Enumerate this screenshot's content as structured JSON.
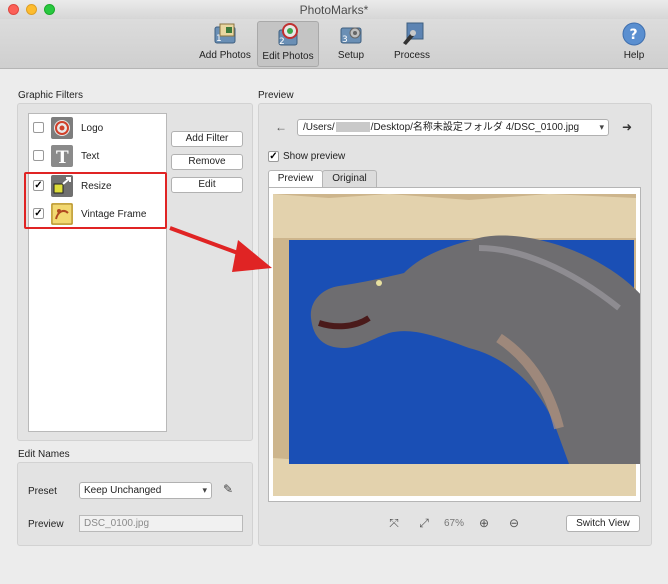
{
  "window": {
    "title": "PhotoMarks*"
  },
  "toolbar": {
    "items": [
      {
        "label": "Add Photos",
        "icon": "add-photos-icon"
      },
      {
        "label": "Edit Photos",
        "icon": "edit-photos-icon",
        "selected": true
      },
      {
        "label": "Setup",
        "icon": "setup-icon"
      },
      {
        "label": "Process",
        "icon": "process-icon"
      },
      {
        "label": "Help",
        "icon": "help-icon"
      }
    ]
  },
  "filters": {
    "heading": "Graphic Filters",
    "items": [
      {
        "label": "Logo",
        "checked": false,
        "icon": "logo-filter-icon"
      },
      {
        "label": "Text",
        "checked": false,
        "icon": "text-filter-icon"
      },
      {
        "label": "Resize",
        "checked": true,
        "icon": "resize-filter-icon"
      },
      {
        "label": "Vintage Frame",
        "checked": true,
        "icon": "vintage-frame-icon"
      }
    ],
    "check_mark": "✓",
    "buttons": {
      "add": "Add Filter",
      "remove": "Remove",
      "edit": "Edit"
    }
  },
  "edit_names": {
    "heading": "Edit Names",
    "preset_label": "Preset",
    "preset_value": "Keep Unchanged",
    "preview_label": "Preview",
    "preview_value": "DSC_0100.jpg"
  },
  "preview": {
    "heading": "Preview",
    "path_prefix": "/Users/",
    "path_suffix": "/Desktop/名称未設定フォルダ 4/DSC_0100.jpg",
    "show_preview_label": "Show preview",
    "show_preview_checked": true,
    "tabs": [
      {
        "label": "Preview",
        "active": true
      },
      {
        "label": "Original",
        "active": false
      }
    ],
    "zoom": "67%",
    "switch_view": "Switch View"
  },
  "colors": {
    "highlight": "#e02424",
    "sky": "#1a4fb5",
    "frame": "#cdb58c"
  }
}
